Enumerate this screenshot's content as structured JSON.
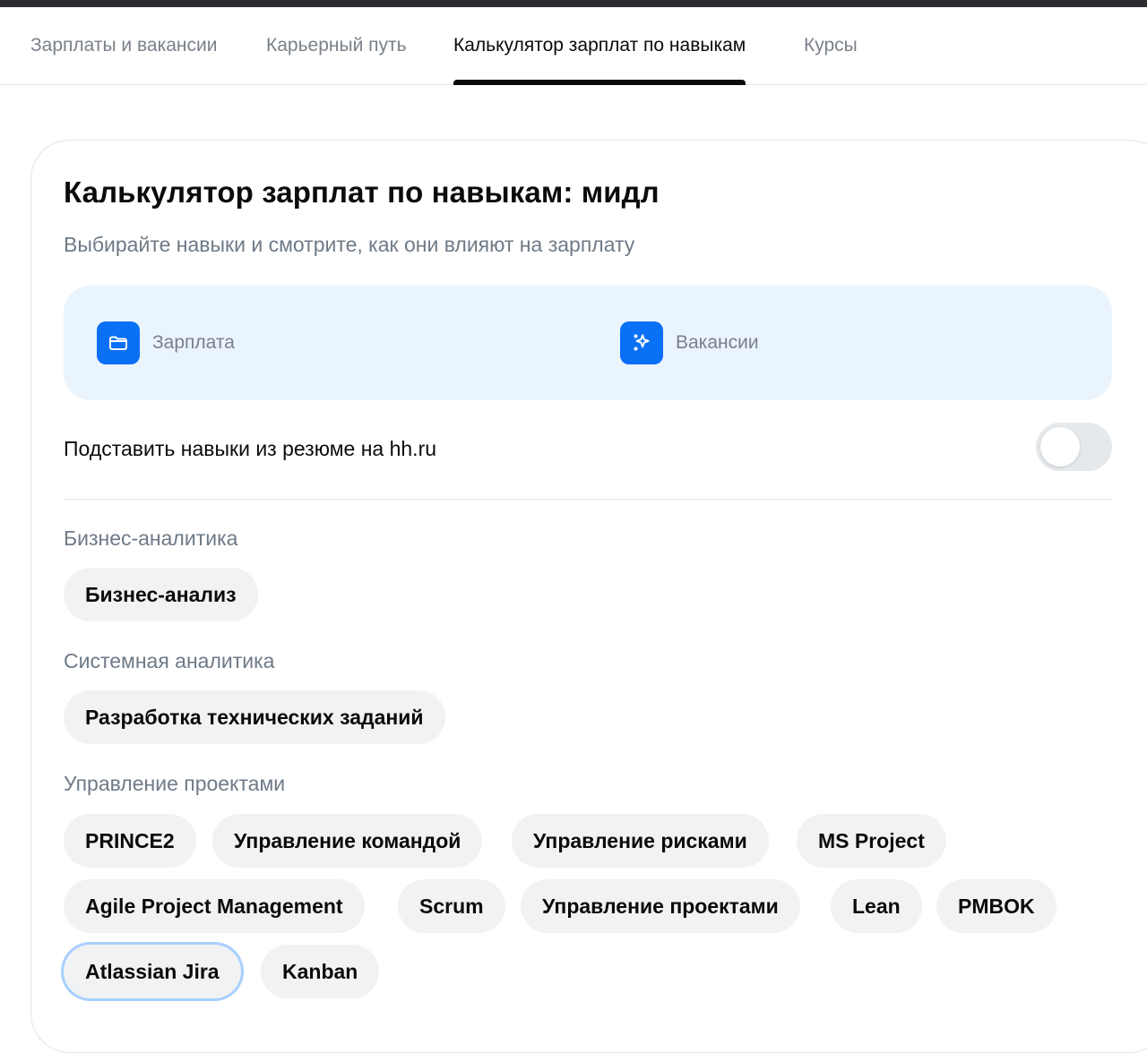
{
  "tabs": [
    {
      "label": "Зарплаты и вакансии"
    },
    {
      "label": "Карьерный путь"
    },
    {
      "label": "Калькулятор зарплат по навыкам"
    },
    {
      "label": "Курсы"
    }
  ],
  "card": {
    "title": "Калькулятор зарплат по навыкам: мидл",
    "subtitle": "Выбирайте навыки и смотрите, как они влияют на зарплату"
  },
  "stats": {
    "salary": {
      "label": "Зарплата",
      "icon": "folder-icon"
    },
    "vacancies": {
      "label": "Вакансии",
      "icon": "sparkles-icon"
    }
  },
  "resume_toggle": {
    "label": "Подставить навыки из резюме на hh.ru",
    "on": false
  },
  "groups": [
    {
      "title": "Бизнес-аналитика",
      "skills": [
        "Бизнес-анализ"
      ]
    },
    {
      "title": "Системная аналитика",
      "skills": [
        "Разработка технических заданий"
      ]
    },
    {
      "title": "Управление проектами",
      "skills": [
        "PRINCE2",
        "Управление командой",
        "Управление рисками",
        "MS Project",
        "Agile Project Management",
        "Scrum",
        "Управление проектами",
        "Lean",
        "PMBOK",
        "Atlassian Jira",
        "Kanban"
      ]
    }
  ],
  "colors": {
    "accent": "#0a70f5",
    "stats_bg": "#eaf4fd",
    "chip_bg": "#f1f2f4",
    "focus_ring": "#a7d0ff"
  }
}
